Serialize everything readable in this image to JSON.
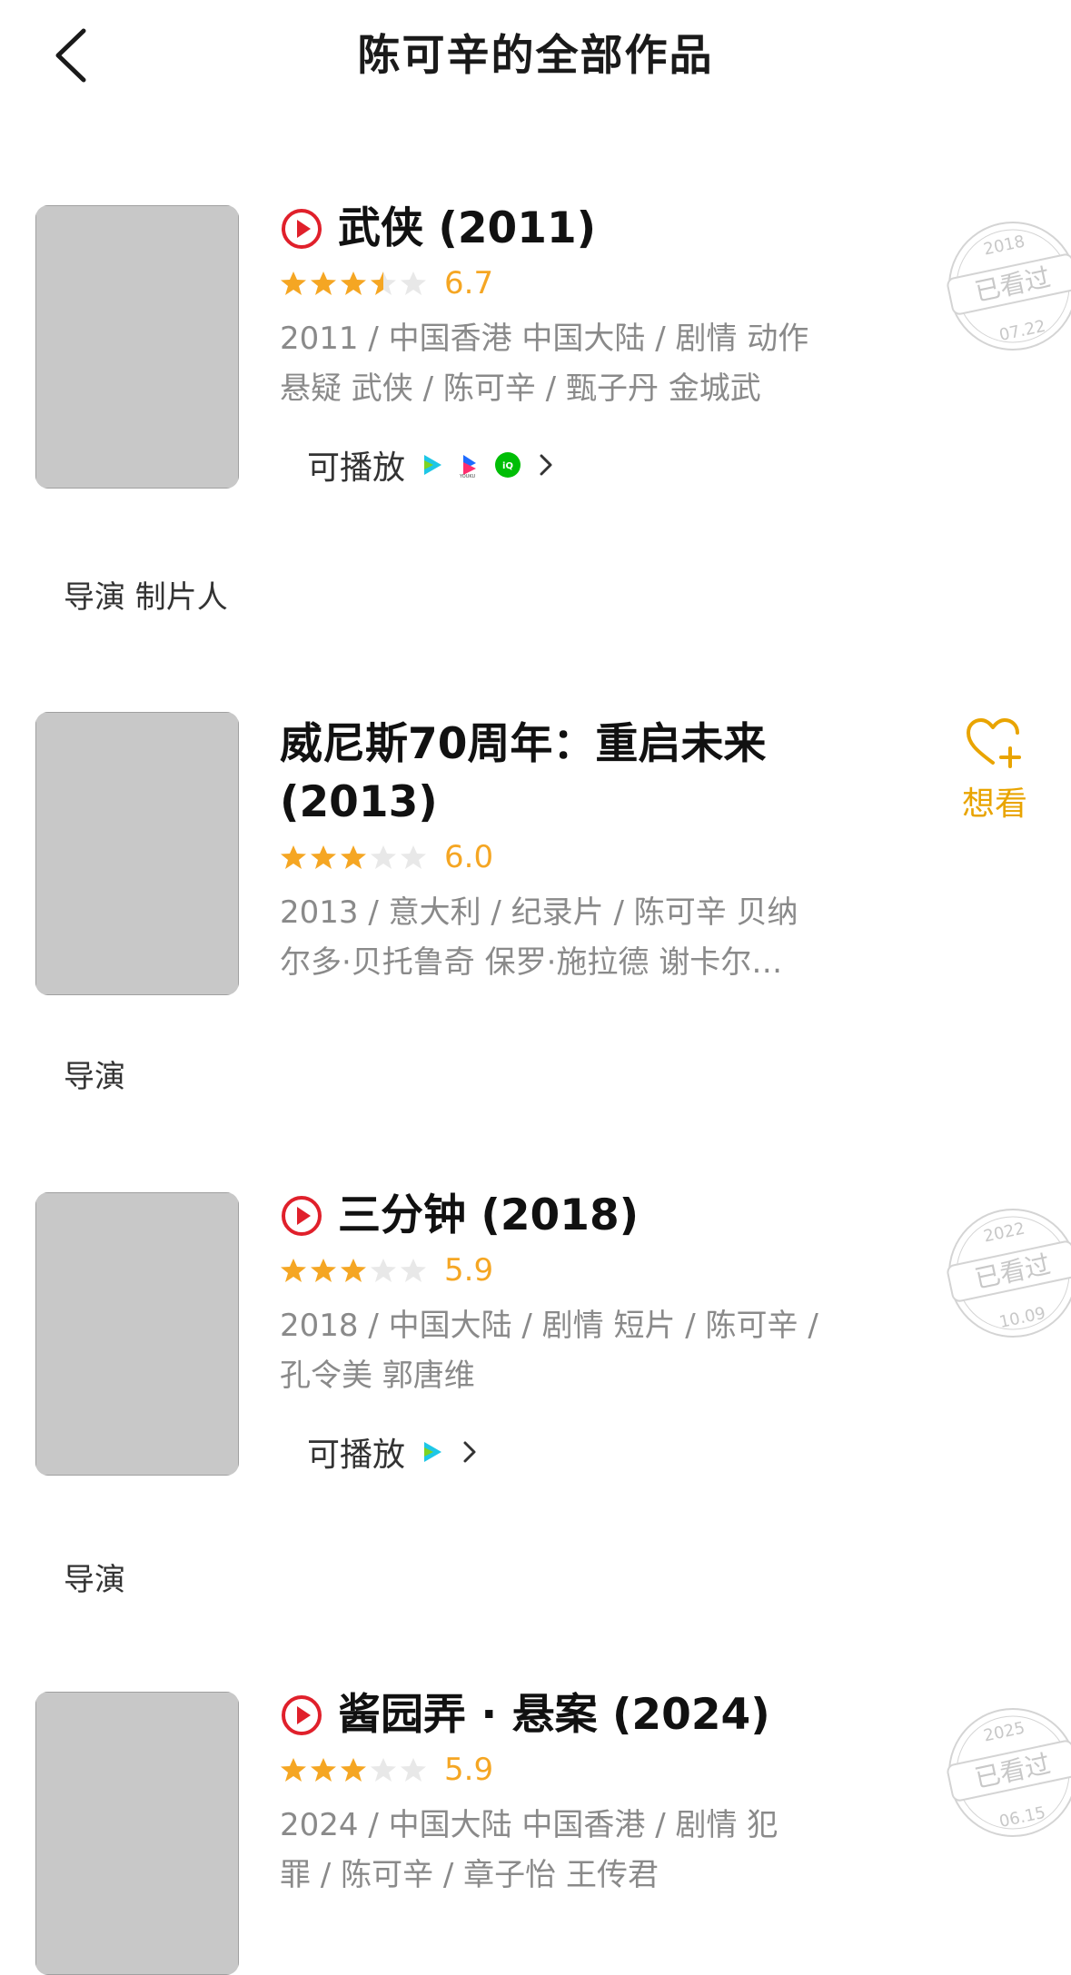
{
  "header": {
    "title": "陈可辛的全部作品"
  },
  "items": [
    {
      "title": "武侠 (2011)",
      "score": "6.7",
      "stars": [
        1,
        1,
        1,
        0.5,
        0
      ],
      "meta_line1": "2011 / 中国香港 中国大陆 / 剧情 动作",
      "meta_line2": "悬疑 武侠 / 陈可辛 / 甄子丹 金城武",
      "play_label": "可播放",
      "platforms": [
        "tencent-video-icon",
        "youku-icon",
        "iqiyi-icon"
      ],
      "role": "导演 制片人",
      "stamp": {
        "year": "2018",
        "text": "已看过",
        "date": "07.22"
      }
    },
    {
      "title_line1": "威尼斯70周年：重启未来",
      "title_line2": "(2013)",
      "score": "6.0",
      "stars": [
        1,
        1,
        1,
        0,
        0
      ],
      "meta_line1": "2013 / 意大利 / 纪录片 / 陈可辛 贝纳",
      "meta_line2": "尔多·贝托鲁奇 保罗·施拉德 谢卡尔…",
      "want_label": "想看",
      "role": "导演"
    },
    {
      "title": "三分钟 (2018)",
      "score": "5.9",
      "stars": [
        1,
        1,
        1,
        0,
        0
      ],
      "meta_line1": "2018 / 中国大陆 / 剧情 短片 / 陈可辛 /",
      "meta_line2": "孔令美 郭唐维",
      "play_label": "可播放",
      "platforms": [
        "tencent-video-icon"
      ],
      "role": "导演",
      "stamp": {
        "year": "2022",
        "text": "已看过",
        "date": "10.09"
      }
    },
    {
      "title": "酱园弄 · 悬案 (2024)",
      "score": "5.9",
      "stars": [
        1,
        1,
        1,
        0,
        0
      ],
      "meta_line1": "2024 / 中国大陆 中国香港 / 剧情 犯",
      "meta_line2": "罪 / 陈可辛 / 章子怡 王传君",
      "stamp": {
        "year": "2025",
        "text": "已看过",
        "date": "06.15"
      }
    }
  ],
  "colors": {
    "accent": "#f5a623",
    "play_red": "#e0202b",
    "want_yellow": "#e9a400",
    "meta_gray": "#8a8a8a"
  }
}
